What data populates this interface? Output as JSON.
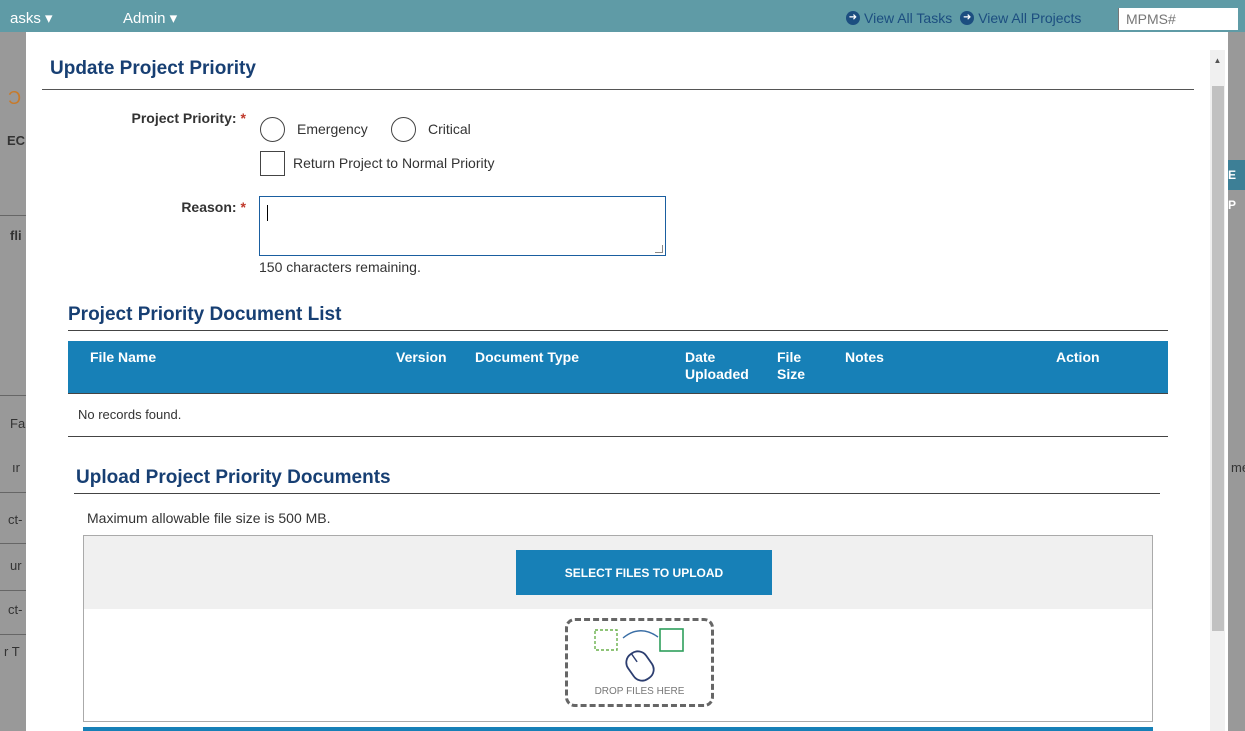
{
  "background": {
    "tasks_menu": "asks ▾",
    "admin_menu": "Admin ▾",
    "view_all_tasks": "View All Tasks",
    "view_all_projects": "View All Projects",
    "mpms_placeholder": "MPMS#",
    "fragments": [
      "Ɔ",
      "EC",
      "fli",
      "Fa",
      "ır",
      "ct-",
      "ur",
      "ct-",
      "r T"
    ],
    "right_fragments": [
      "E P",
      "me"
    ]
  },
  "modal": {
    "title": "Update Project Priority",
    "priority_label": "Project Priority:",
    "required_mark": "*",
    "options": [
      "Emergency",
      "Critical"
    ],
    "return_normal_label": "Return Project to Normal Priority",
    "reason_label": "Reason:",
    "reason_value": "",
    "chars_remaining": "150 characters remaining.",
    "doc_list_title": "Project Priority Document List",
    "table_headers": {
      "file_name": "File Name",
      "version": "Version",
      "document_type": "Document Type",
      "date_uploaded": "Date Uploaded",
      "file_size": "File Size",
      "notes": "Notes",
      "action": "Action"
    },
    "no_records": "No records found.",
    "upload_title": "Upload Project Priority Documents",
    "max_size": "Maximum allowable file size is 500 MB.",
    "select_files": "SELECT FILES TO UPLOAD",
    "drop_files": "DROP FILES HERE"
  },
  "colors": {
    "primary": "#1780b7",
    "title": "#173f73",
    "required": "#c0392b"
  }
}
